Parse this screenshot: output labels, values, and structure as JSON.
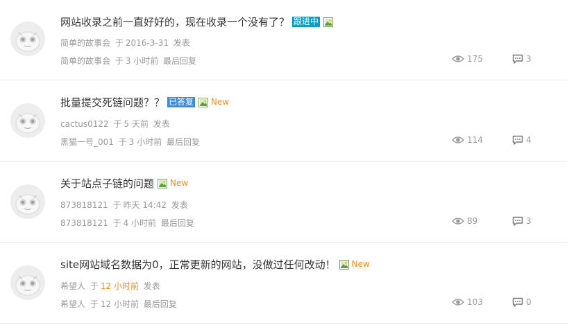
{
  "threads": [
    {
      "title": "网站收录之前一直好好的，现在收录一个没有了？",
      "tag": "跟进中",
      "tag_type": "follow",
      "has_image": true,
      "is_new": false,
      "author": "简单的故事会",
      "post_prefix": "于",
      "post_time": "2016-3-31",
      "post_suffix": "发表",
      "post_time_highlight": false,
      "last_replier": "简单的故事会",
      "reply_prefix": "于",
      "reply_time": "3 小时前",
      "reply_suffix": "最后回复",
      "views": "175",
      "replies": "3"
    },
    {
      "title": "批量提交死链问题？？",
      "tag": "已答复",
      "tag_type": "answered",
      "has_image": true,
      "is_new": true,
      "new_label": "New",
      "author": "cactus0122",
      "post_prefix": "于",
      "post_time": "5 天前",
      "post_suffix": "发表",
      "post_time_highlight": false,
      "last_replier": "黑猫一号_001",
      "reply_prefix": "于",
      "reply_time": "3 小时前",
      "reply_suffix": "最后回复",
      "views": "114",
      "replies": "4"
    },
    {
      "title": "关于站点子链的问题",
      "tag": "",
      "tag_type": "",
      "has_image": true,
      "is_new": true,
      "new_label": "New",
      "author": "873818121",
      "post_prefix": "于",
      "post_time": "昨天 14:42",
      "post_suffix": "发表",
      "post_time_highlight": false,
      "last_replier": "873818121",
      "reply_prefix": "于",
      "reply_time": "4 小时前",
      "reply_suffix": "最后回复",
      "views": "89",
      "replies": "3"
    },
    {
      "title": "site网站域名数据为0，正常更新的网站，没做过任何改动！",
      "tag": "",
      "tag_type": "",
      "has_image": true,
      "is_new": true,
      "new_label": "New",
      "author": "希望人",
      "post_prefix": "于",
      "post_time": "12 小时前",
      "post_suffix": "发表",
      "post_time_highlight": true,
      "last_replier": "希望人",
      "reply_prefix": "于",
      "reply_time": "12 小时前",
      "reply_suffix": "最后回复",
      "views": "103",
      "replies": "0"
    }
  ],
  "icons": {
    "avatar": "default-avatar-icon",
    "image": "image-attachment-icon",
    "views": "eye-icon",
    "replies": "comment-icon"
  },
  "colors": {
    "tag_follow": "#00a2ca",
    "tag_answered": "#3c8dd8",
    "new": "#f08c1e",
    "meta": "#999999",
    "title": "#333333"
  }
}
